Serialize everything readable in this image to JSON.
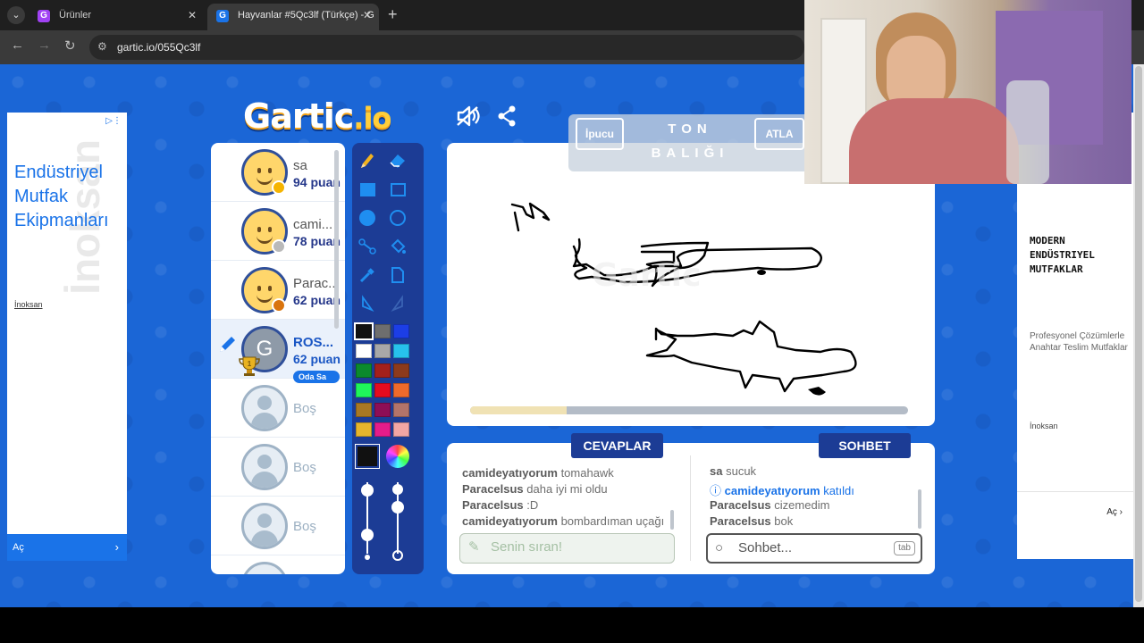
{
  "browser": {
    "tabs": [
      {
        "label": "Ürünler",
        "favicon": "G"
      },
      {
        "label": "Hayvanlar #5Qc3lf (Türkçe) - G",
        "favicon": "G"
      }
    ],
    "url": "gartic.io/055Qc3lf"
  },
  "logo": {
    "main": "Gartic",
    "suffix": ".io"
  },
  "ad_left": {
    "headline": "Endüstriyel Mutfak Ekipmanları",
    "brand": "İnoksan",
    "watermark": "İnoksan",
    "cta": "Aç"
  },
  "ad_right": {
    "headline": "MODERN ENDÜSTRIYEL MUTFAKLAR",
    "subtext": "Profesyonel Çözümlerle Anahtar Teslim Mutfaklar",
    "brand": "İnoksan",
    "cta": "Aç"
  },
  "hint": {
    "hint_label": "İpucu",
    "skip_label": "ATLA",
    "word_line1": "TON",
    "word_line2": "BALIĞI"
  },
  "players": [
    {
      "name": "sa",
      "score": "94 puan",
      "status_color": "#f5b400"
    },
    {
      "name": "cami...",
      "score": "78 puan",
      "status_color": "#b9b9b9"
    },
    {
      "name": "Parac...",
      "score": "62 puan",
      "status_color": "#d9740d"
    },
    {
      "name": "ROS...",
      "score": "62 puan",
      "initial": "G",
      "badge": "Oda Sa"
    },
    {
      "name": "Boş"
    },
    {
      "name": "Boş"
    },
    {
      "name": "Boş"
    }
  ],
  "timer_progress": 0.22,
  "palette": [
    "#111111",
    "#6e6e6e",
    "#1c3ee6",
    "#ffffff",
    "#a8a8a8",
    "#27c2ec",
    "#0b8a2c",
    "#a3201b",
    "#8c3a1c",
    "#1ff55a",
    "#e60b1f",
    "#ee6a2b",
    "#a87823",
    "#8e0e56",
    "#b3746a",
    "#e6b52c",
    "#e51c8a",
    "#f2a6a4"
  ],
  "tabs": {
    "answers": "CEVAPLAR",
    "chat": "SOHBET"
  },
  "answers": [
    {
      "user": "camideyatıyorum",
      "text": "tomahawk"
    },
    {
      "user": "Paracelsus",
      "text": "daha iyi mi oldu"
    },
    {
      "user": "Paracelsus",
      "text": ":D"
    },
    {
      "user": "camideyatıyorum",
      "text": "bombardıman uçağı"
    }
  ],
  "chat": [
    {
      "user": "sa",
      "text": "sucuk"
    },
    {
      "user": "camideyatıyorum",
      "text": "katıldı",
      "system": true
    },
    {
      "user": "Paracelsus",
      "text": "cizemedim"
    },
    {
      "user": "Paracelsus",
      "text": "bok"
    }
  ],
  "answer_placeholder": "Senin sıran!",
  "chat_placeholder": "Sohbet...",
  "chat_key_hint": "tab"
}
